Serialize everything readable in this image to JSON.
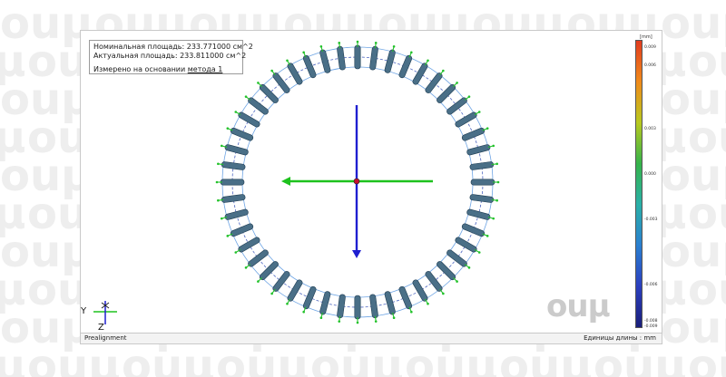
{
  "watermark_text": "ouμ",
  "info": {
    "nominal": "Номинальная площадь: 233.771000 см^2",
    "actual": "Актуальная площадь: 233.811000 см^2",
    "method_prefix": "Измерено на основании ",
    "method_link": "метода 1"
  },
  "colorbar": {
    "unit": "[mm]",
    "labels": [
      "0.009",
      "0.006",
      "0.003",
      "0.000",
      "-0.003",
      "-0.006",
      "-0.008",
      "-0.009"
    ],
    "colors": [
      "#e23b1f",
      "#f08a1a",
      "#b8c91f",
      "#35b34a",
      "#2ab0a8",
      "#2a7fd0",
      "#2b3fbf",
      "#1a1f7a"
    ]
  },
  "triad": {
    "y_label": "Y",
    "z_label": "Z",
    "x_label": "X"
  },
  "brand": "ouμ",
  "status": {
    "left": "Prealignment",
    "right": "Единицы длины : mm"
  },
  "scene": {
    "tooth_count": 48,
    "tooth_color": "#4a6f87",
    "ring_color": "#2f7ed8",
    "arrow_color": "#22c22a",
    "axis_x_color": "#1ec21e",
    "axis_y_color": "#1f1fd0",
    "center_color": "#c8102e"
  }
}
